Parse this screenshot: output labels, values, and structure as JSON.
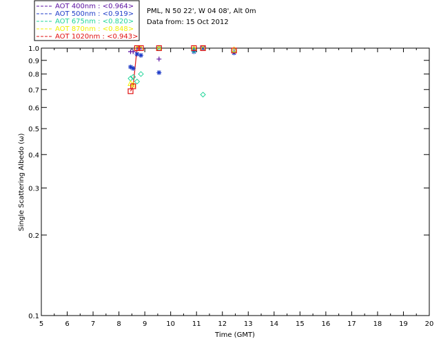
{
  "chart_data": {
    "type": "scatter",
    "xlabel": "Time (GMT)",
    "ylabel": "Single Scattering Albedo (ω)",
    "xlim": [
      5,
      20
    ],
    "ylim": [
      0.1,
      1.0
    ],
    "yscale": "log",
    "x_ticks": [
      5,
      6,
      7,
      8,
      9,
      10,
      11,
      12,
      13,
      14,
      15,
      16,
      17,
      18,
      19,
      20
    ],
    "y_ticks": [
      0.1,
      0.2,
      0.3,
      0.4,
      0.5,
      0.6,
      0.7,
      0.8,
      0.9,
      1.0
    ],
    "y_tick_labels": [
      "0.1",
      "0.2",
      "0.3",
      "0.4",
      "0.5",
      "0.6",
      "0.7",
      "0.8",
      "0.9",
      "1.0"
    ],
    "info": {
      "location": "PML, N 50 22', W 04 08', Alt 0m",
      "date": "Data from: 15 Oct 2012"
    },
    "series": [
      {
        "label": "AOT  400nm : <0.964>",
        "color": "#5a0fa0",
        "marker": "plus",
        "points": [
          [
            8.45,
            0.97
          ],
          [
            8.55,
            0.97
          ],
          [
            8.7,
            1.0
          ],
          [
            8.85,
            1.0
          ],
          [
            9.55,
            0.91
          ],
          [
            10.9,
            0.99
          ],
          [
            11.25,
            1.0
          ],
          [
            12.45,
            0.97
          ]
        ]
      },
      {
        "label": "AOT  500nm : <0.919>",
        "color": "#1f3cc8",
        "marker": "asterisk",
        "points": [
          [
            8.45,
            0.85
          ],
          [
            8.55,
            0.84
          ],
          [
            8.7,
            0.95
          ],
          [
            8.85,
            0.94
          ],
          [
            9.55,
            0.81
          ],
          [
            10.9,
            0.97
          ],
          [
            11.25,
            1.0
          ],
          [
            12.45,
            0.96
          ]
        ]
      },
      {
        "label": "AOT  675nm : <0.820>",
        "color": "#22d69a",
        "marker": "diamond",
        "points": [
          [
            8.45,
            0.77
          ],
          [
            8.55,
            0.78
          ],
          [
            8.7,
            0.75
          ],
          [
            8.85,
            0.8
          ],
          [
            9.55,
            1.0
          ],
          [
            10.9,
            0.98
          ],
          [
            11.25,
            0.67
          ],
          [
            12.45,
            0.98
          ]
        ]
      },
      {
        "label": "AOT  870nm : <0.848>",
        "color": "#f0f000",
        "marker": "triangle",
        "points": [
          [
            8.45,
            0.74
          ],
          [
            8.55,
            0.73
          ],
          [
            8.7,
            1.0
          ],
          [
            8.85,
            1.0
          ],
          [
            9.55,
            1.0
          ],
          [
            10.9,
            1.0
          ],
          [
            11.25,
            1.0
          ],
          [
            12.45,
            0.99
          ]
        ]
      },
      {
        "label": "AOT 1020nm : <0.943>",
        "color": "#e01010",
        "marker": "square",
        "points": [
          [
            8.45,
            0.69
          ],
          [
            8.55,
            0.72
          ],
          [
            8.7,
            1.0
          ],
          [
            8.85,
            1.0
          ],
          [
            9.55,
            1.0
          ],
          [
            10.9,
            1.0
          ],
          [
            11.25,
            1.0
          ],
          [
            12.45,
            0.98
          ]
        ]
      }
    ],
    "line_series": {
      "color": "#e01010",
      "points": [
        [
          8.45,
          0.69
        ],
        [
          8.55,
          0.72
        ],
        [
          8.7,
          1.0
        ],
        [
          8.85,
          1.0
        ]
      ]
    }
  }
}
